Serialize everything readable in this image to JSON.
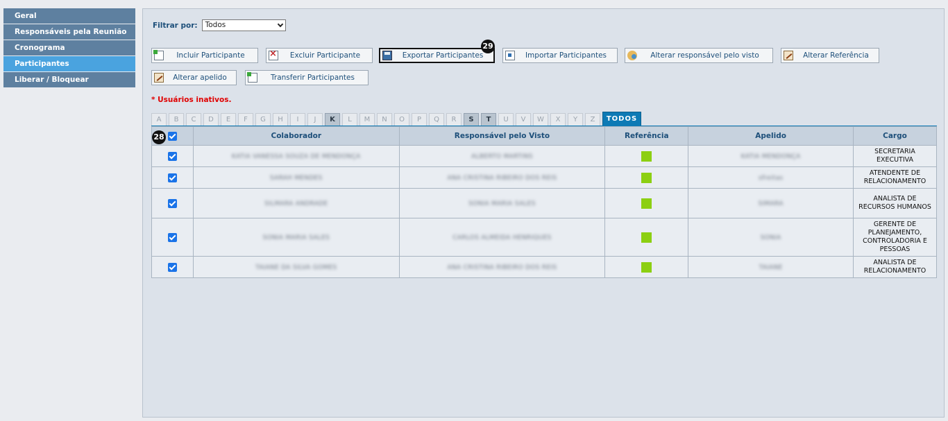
{
  "sidebar": {
    "items": [
      {
        "label": "Geral"
      },
      {
        "label": "Responsáveis pela Reunião"
      },
      {
        "label": "Cronograma"
      },
      {
        "label": "Participantes"
      },
      {
        "label": "Liberar / Bloquear"
      }
    ]
  },
  "filter": {
    "label": "Filtrar por:",
    "value": "Todos"
  },
  "buttons": {
    "incluir": "Incluir Participante",
    "excluir": "Excluir Participante",
    "exportar": "Exportar Participantes",
    "importar": "Importar Participantes",
    "alterar_responsavel": "Alterar responsável pelo visto",
    "alterar_referencia": "Alterar Referência",
    "alterar_apelido": "Alterar apelido",
    "transferir": "Transferir Participantes"
  },
  "badges": {
    "export": "29",
    "select_all": "28"
  },
  "inactive_note": "* Usuários inativos.",
  "letters": [
    "A",
    "B",
    "C",
    "D",
    "E",
    "F",
    "G",
    "H",
    "I",
    "J",
    "K",
    "L",
    "M",
    "N",
    "O",
    "P",
    "Q",
    "R",
    "S",
    "T",
    "U",
    "V",
    "W",
    "X",
    "Y",
    "Z"
  ],
  "letters_enabled": [
    "K",
    "S",
    "T"
  ],
  "letter_all": "TODOS",
  "table": {
    "headers": {
      "colaborador": "Colaborador",
      "responsavel": "Responsável pelo Visto",
      "referencia": "Referência",
      "apelido": "Apelido",
      "cargo": "Cargo"
    },
    "rows": [
      {
        "colaborador": "KATIA VANESSA SOUZA DE MENDONÇA",
        "responsavel": "ALBERTO MARTINS",
        "apelido": "KATIA MENDONÇA",
        "cargo": "SECRETARIA EXECUTIVA",
        "ref_color": "#8ccf12"
      },
      {
        "colaborador": "SARAH MENDES",
        "responsavel": "ANA CRISTINA RIBEIRO DOS REIS",
        "apelido": "sfreitas",
        "cargo": "ATENDENTE DE RELACIONAMENTO",
        "ref_color": "#8ccf12"
      },
      {
        "colaborador": "SILMARA ANDRADE",
        "responsavel": "SONIA MARIA SALES",
        "apelido": "SIMARA",
        "cargo": "ANALISTA DE RECURSOS HUMANOS",
        "ref_color": "#8ccf12"
      },
      {
        "colaborador": "SONIA MARIA SALES",
        "responsavel": "CARLOS ALMEIDA HENRIQUES",
        "apelido": "SONIA",
        "cargo": "GERENTE DE PLANEJAMENTO, CONTROLADORIA E PESSOAS",
        "ref_color": "#8ccf12"
      },
      {
        "colaborador": "TAIANE DA SILVA GOMES",
        "responsavel": "ANA CRISTINA RIBEIRO DOS REIS",
        "apelido": "TAIANE",
        "cargo": "ANALISTA DE RELACIONAMENTO",
        "ref_color": "#8ccf12"
      }
    ]
  }
}
